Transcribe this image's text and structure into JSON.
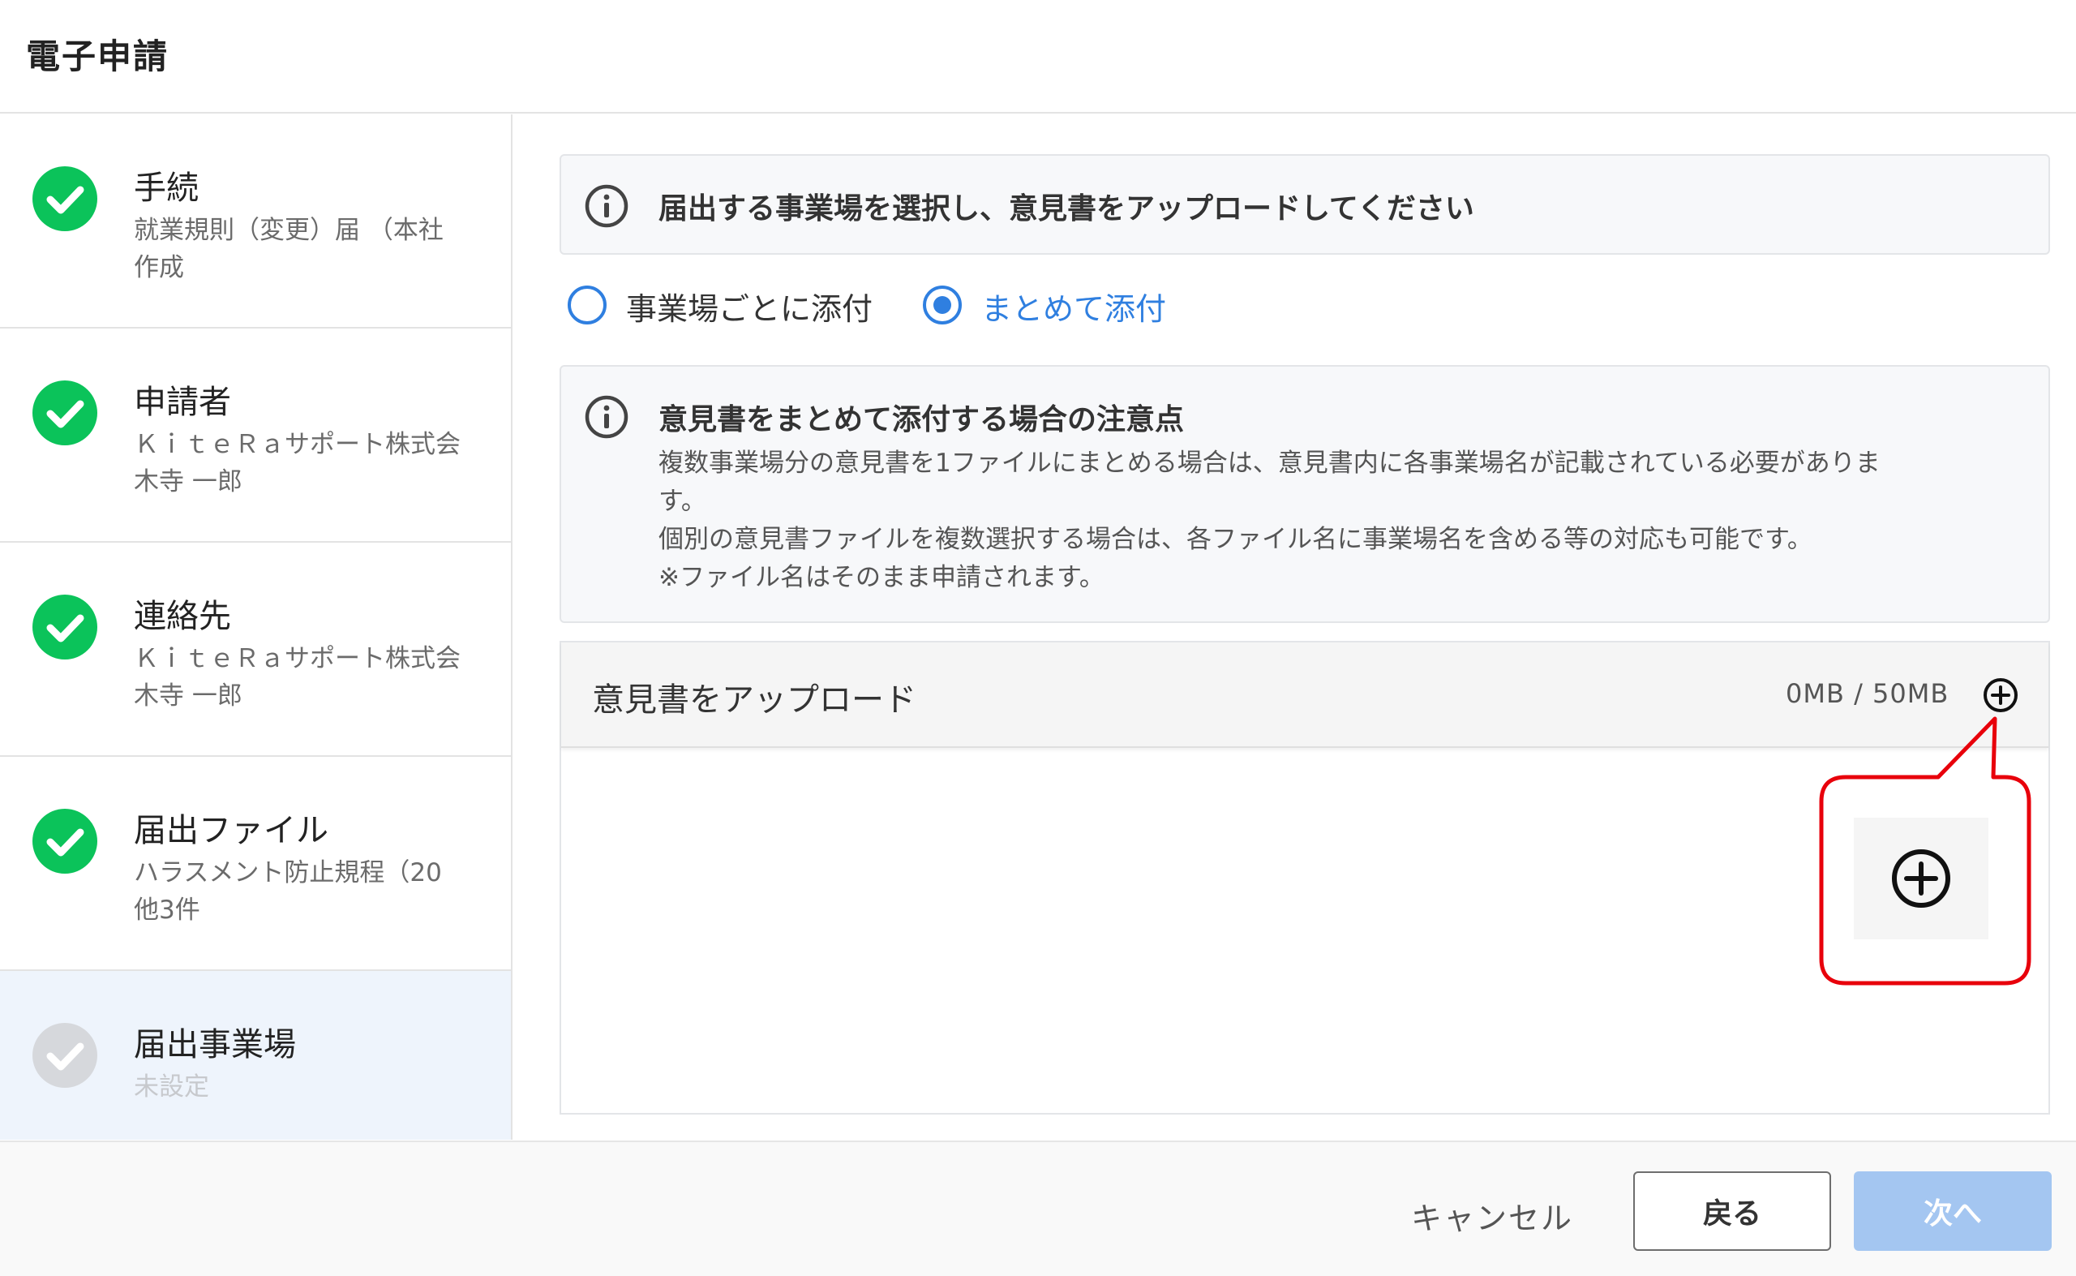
{
  "header": {
    "title": "電子申請"
  },
  "sidebar": {
    "steps": [
      {
        "title": "手続",
        "sub": [
          "就業規則（変更）届 （本社",
          "作成"
        ],
        "status": "done"
      },
      {
        "title": "申請者",
        "sub": [
          "ＫｉｔｅＲａサポート株式会",
          "木寺 一郎"
        ],
        "status": "done"
      },
      {
        "title": "連絡先",
        "sub": [
          "ＫｉｔｅＲａサポート株式会",
          "木寺 一郎"
        ],
        "status": "done"
      },
      {
        "title": "届出ファイル",
        "sub": [
          "ハラスメント防止規程（20",
          "他3件"
        ],
        "status": "done"
      },
      {
        "title": "届出事業場",
        "sub": [
          "未設定"
        ],
        "status": "pending"
      }
    ]
  },
  "main": {
    "instruction": "届出する事業場を選択し、意見書をアップロードしてください",
    "radio_options": [
      {
        "label": "事業場ごとに添付",
        "selected": false
      },
      {
        "label": "まとめて添付",
        "selected": true
      }
    ],
    "notice": {
      "title": "意見書をまとめて添付する場合の注意点",
      "lines": [
        "複数事業場分の意見書を1ファイルにまとめる場合は、意見書内に各事業場名が記載されている必要がありま",
        "す。",
        "個別の意見書ファイルを複数選択する場合は、各ファイル名に事業場名を含める等の対応も可能です。",
        "※ファイル名はそのまま申請されます。"
      ]
    },
    "upload": {
      "title": "意見書をアップロード",
      "size": "0MB / 50MB"
    }
  },
  "footer": {
    "cancel_label": "キャンセル",
    "back_label": "戻る",
    "next_label": "次へ"
  },
  "colors": {
    "check_done": "#0bc35a",
    "check_pending": "#d6d8dc",
    "accent": "#2f7fe0",
    "next_disabled": "#a4c6f1",
    "callout": "#e8000b",
    "active_step_bg": "#eef4fc"
  },
  "icons": {
    "step_done": "check-circle-icon",
    "step_pending": "check-circle-icon",
    "info": "info-circle-icon",
    "add": "plus-circle-icon"
  }
}
